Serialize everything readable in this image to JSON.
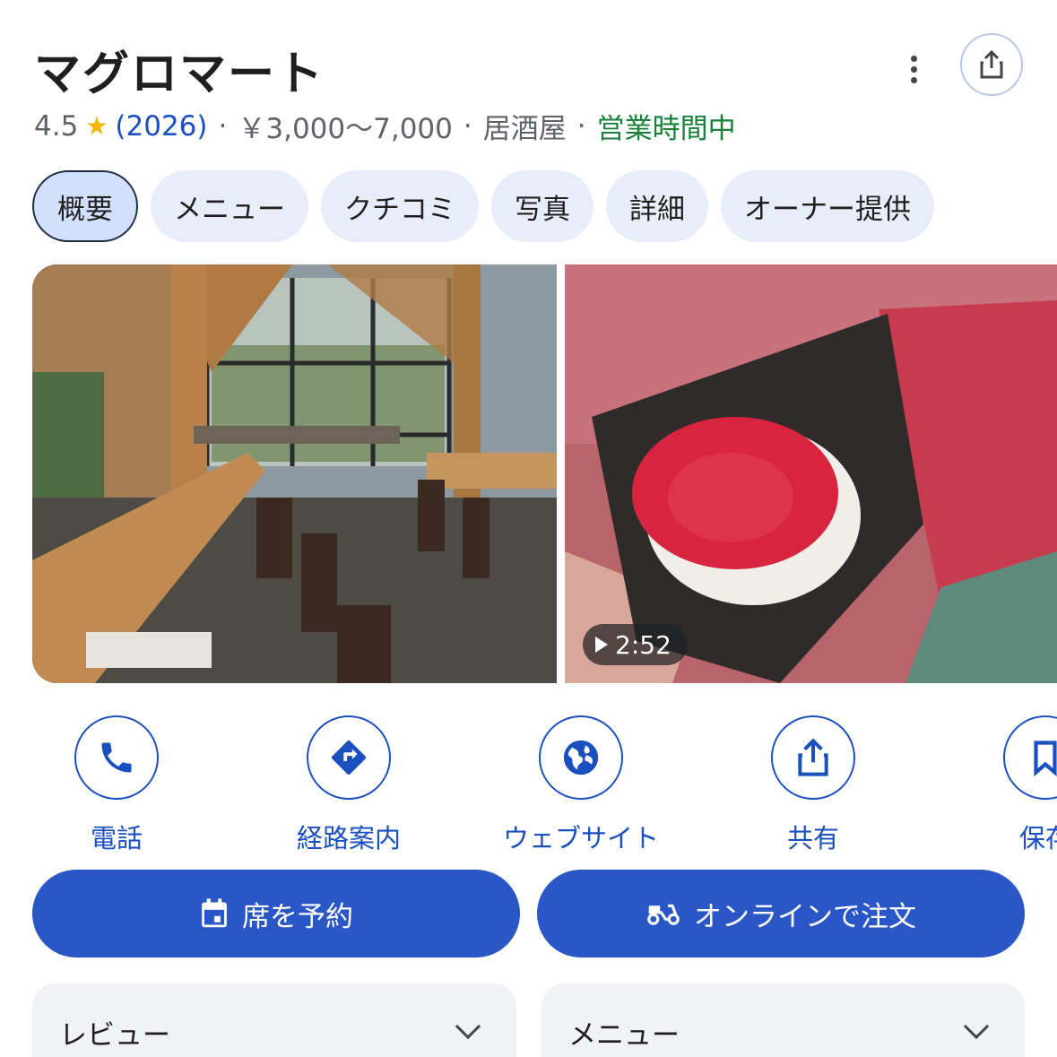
{
  "place": {
    "name": "マグロマート",
    "rating": "4.5",
    "review_count": "(2026)",
    "price_range": "￥3,000〜7,000",
    "category": "居酒屋",
    "status": "営業時間中"
  },
  "tabs": [
    "概要",
    "メニュー",
    "クチコミ",
    "写真",
    "詳細",
    "オーナー提供"
  ],
  "active_tab": "概要",
  "photos": {
    "video_duration": "2:52"
  },
  "actions": [
    {
      "label": "電話",
      "icon": "phone-icon"
    },
    {
      "label": "経路案内",
      "icon": "directions-icon"
    },
    {
      "label": "ウェブサイト",
      "icon": "globe-icon"
    },
    {
      "label": "共有",
      "icon": "share-icon"
    },
    {
      "label": "保存",
      "icon": "bookmark-icon"
    }
  ],
  "buttons": {
    "reserve": "席を予約",
    "order": "オンラインで注文"
  },
  "cards": {
    "reviews": "レビュー",
    "menu": "メニュー"
  },
  "colors": {
    "accent": "#2a56c6",
    "link": "#1a4fbf",
    "open": "#188038",
    "star": "#f4b400"
  }
}
